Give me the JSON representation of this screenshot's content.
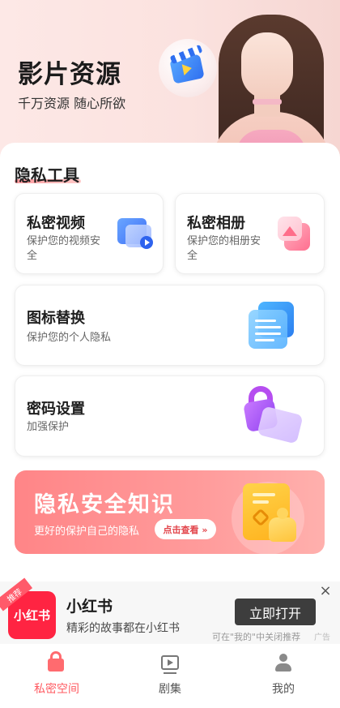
{
  "hero": {
    "title": "影片资源",
    "subtitle": "千万资源 随心所欲"
  },
  "section": {
    "title": "隐私工具"
  },
  "cards": [
    {
      "title": "私密视频",
      "desc": "保护您的视频安全",
      "icon": "video-folder-icon"
    },
    {
      "title": "私密相册",
      "desc": "保护您的相册安全",
      "icon": "photo-album-icon"
    },
    {
      "title": "图标替换",
      "desc": "保护您的个人隐私",
      "icon": "document-list-icon"
    },
    {
      "title": "密码设置",
      "desc": "加强保护",
      "icon": "padlock-icon"
    }
  ],
  "banner": {
    "title": "隐私安全知识",
    "subtitle": "更好的保护自己的隐私",
    "button": "点击查看 »"
  },
  "ad": {
    "tag": "推荐",
    "logo_text": "小红书",
    "name": "小红书",
    "desc": "精彩的故事都在小红书",
    "open_button": "立即打开",
    "close": "×",
    "note": "可在\"我的\"中关闭推荐",
    "badge": "广告"
  },
  "nav": {
    "items": [
      {
        "label": "私密空间",
        "active": true
      },
      {
        "label": "剧集",
        "active": false
      },
      {
        "label": "我的",
        "active": false
      }
    ]
  },
  "colors": {
    "accent": "#ff5b62",
    "banner": "#ff8f90",
    "ad_brand": "#ff2442"
  }
}
